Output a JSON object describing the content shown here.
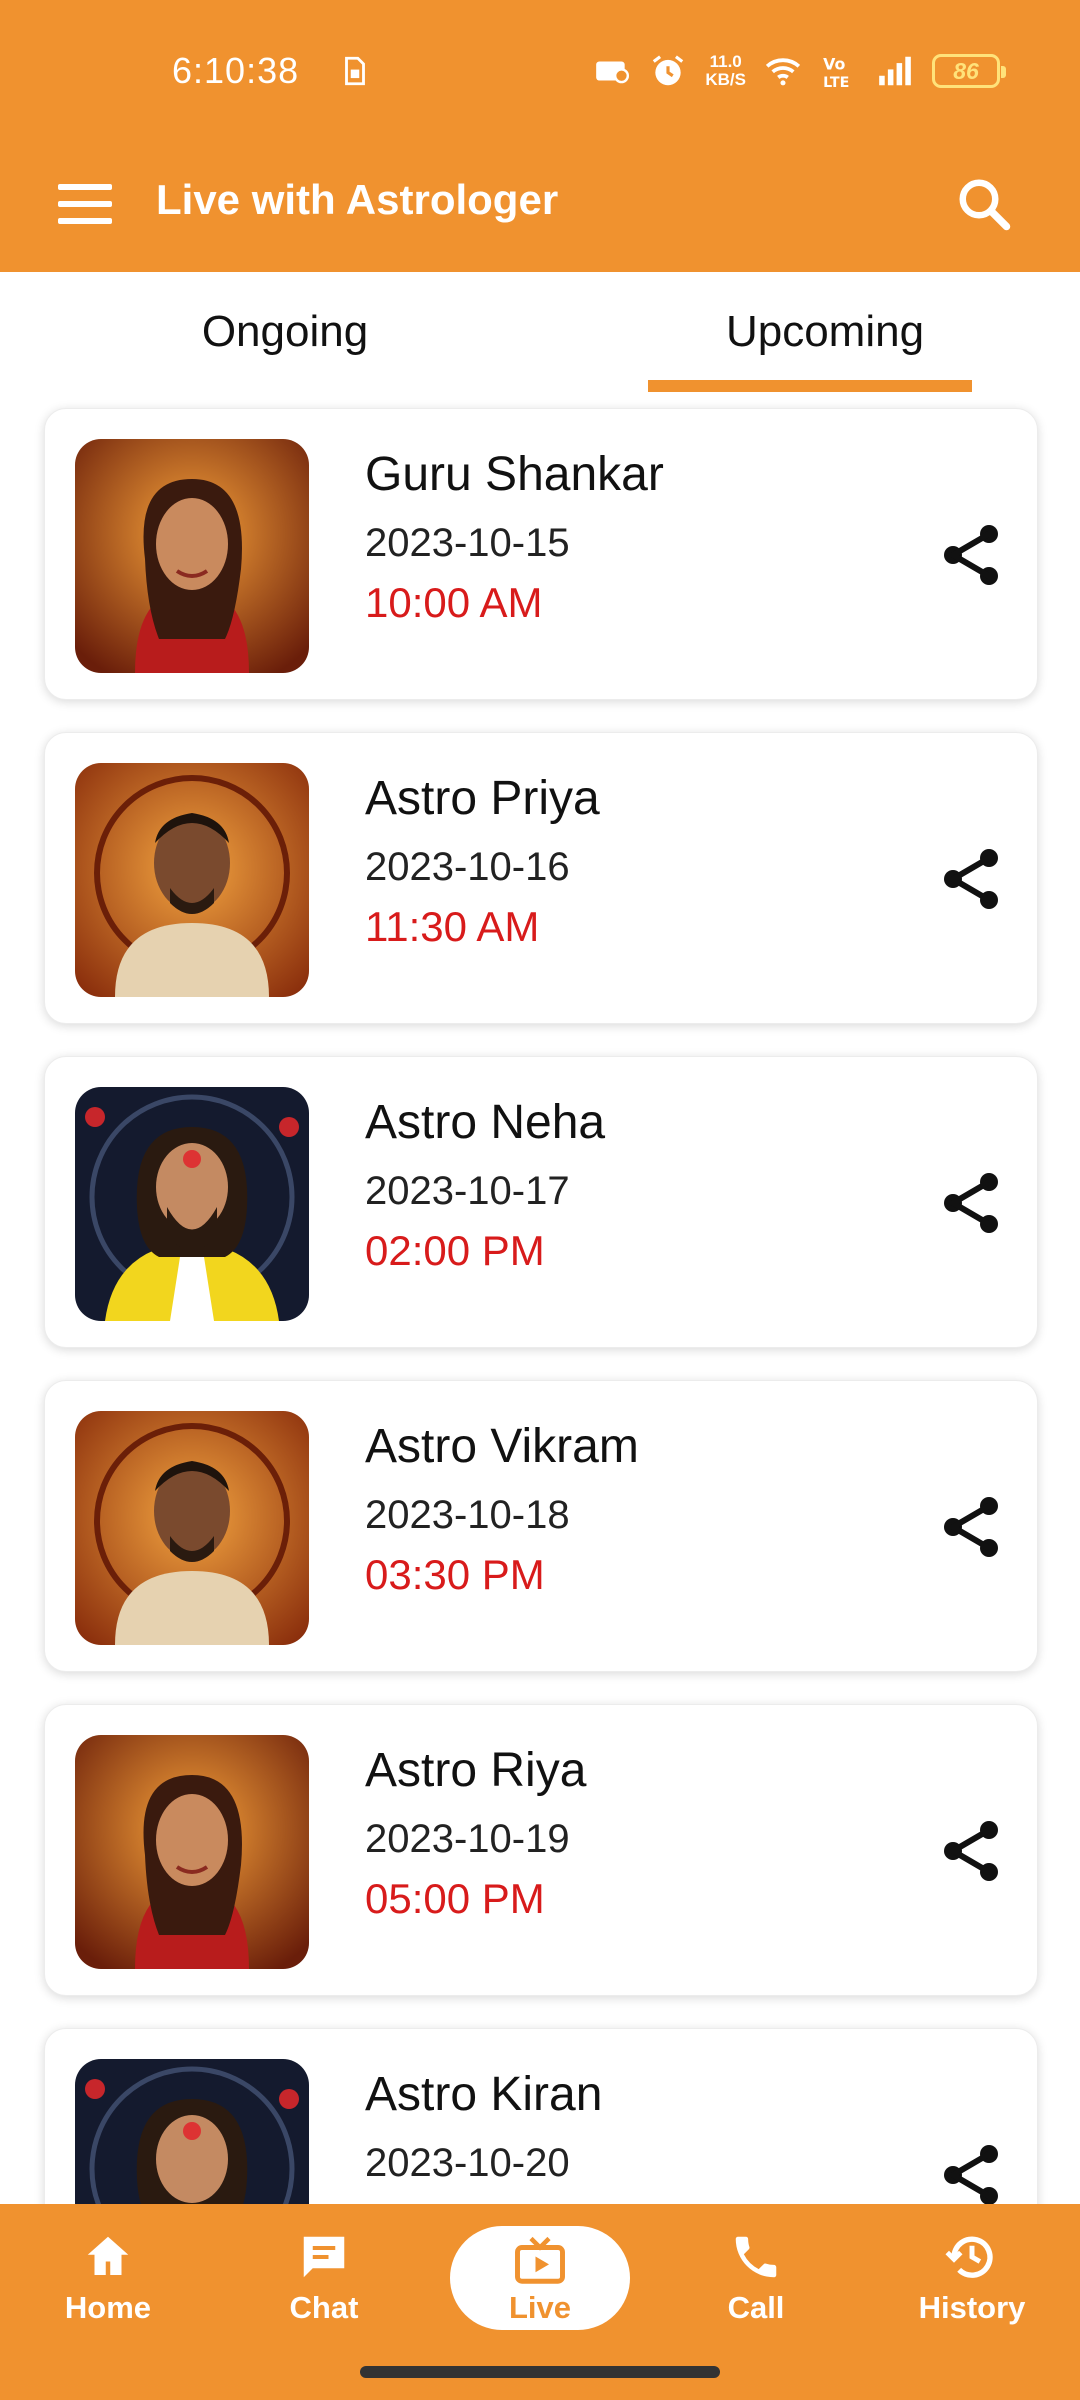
{
  "status_bar": {
    "time": "6:10:38",
    "net_speed_value": "11.0",
    "net_speed_unit": "KB/S",
    "volte_label": "Vo LTE",
    "battery_level": "86",
    "icons": [
      "sim-card-icon",
      "alarm-clock-icon",
      "wifi-icon",
      "volte-icon",
      "signal-bars-icon",
      "battery-icon"
    ]
  },
  "app_bar": {
    "title": "Live with Astrologer",
    "menu_icon": "hamburger-menu-icon",
    "search_icon": "search-icon"
  },
  "tabs": [
    {
      "label": "Ongoing",
      "selected": false
    },
    {
      "label": "Upcoming",
      "selected": true
    }
  ],
  "colors": {
    "accent": "#F0922F",
    "time_text": "#D81B1B",
    "card_background": "#FFFFFF"
  },
  "sessions": [
    {
      "name": "Guru Shankar",
      "date": "2023-10-15",
      "time": "10:00 AM",
      "avatar": "female-astrologer-portrait"
    },
    {
      "name": "Astro Priya",
      "date": "2023-10-16",
      "time": "11:30 AM",
      "avatar": "male-astrologer-portrait"
    },
    {
      "name": "Astro Neha",
      "date": "2023-10-17",
      "time": "02:00 PM",
      "avatar": "guru-yellow-shawl-portrait"
    },
    {
      "name": "Astro Vikram",
      "date": "2023-10-18",
      "time": "03:30 PM",
      "avatar": "male-astrologer-portrait"
    },
    {
      "name": "Astro Riya",
      "date": "2023-10-19",
      "time": "05:00 PM",
      "avatar": "female-astrologer-portrait"
    },
    {
      "name": "Astro Kiran",
      "date": "2023-10-20",
      "time": "",
      "avatar": "guru-yellow-shawl-portrait"
    }
  ],
  "bottom_nav": [
    {
      "label": "Home",
      "icon": "home-icon",
      "selected": false
    },
    {
      "label": "Chat",
      "icon": "chat-icon",
      "selected": false
    },
    {
      "label": "Live",
      "icon": "live-tv-icon",
      "selected": true
    },
    {
      "label": "Call",
      "icon": "phone-icon",
      "selected": false
    },
    {
      "label": "History",
      "icon": "history-icon",
      "selected": false
    }
  ]
}
